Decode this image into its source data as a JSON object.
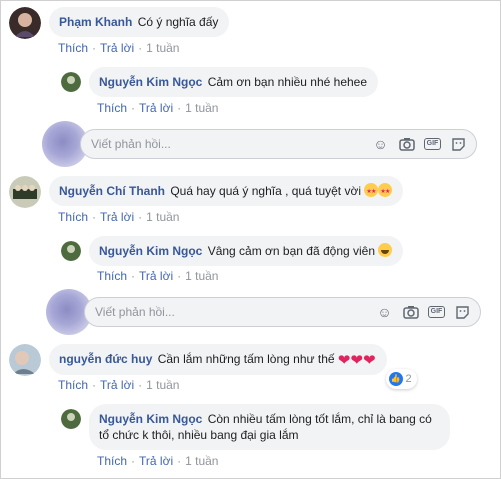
{
  "comments": [
    {
      "name": "Phạm Khanh",
      "text": "Có ý nghĩa đấy",
      "like": "Thích",
      "reply": "Trả lời",
      "time": "1 tuần"
    },
    {
      "name": "Nguyễn Kim Ngọc",
      "text": "Cảm ơn bạn nhiều nhé hehee",
      "like": "Thích",
      "reply": "Trả lời",
      "time": "1 tuần"
    },
    {
      "name": "Nguyễn Chí Thanh",
      "text": "Quá hay quá ý nghĩa , quá tuyệt vời",
      "emoji": "star-struck-icon",
      "like": "Thích",
      "reply": "Trả lời",
      "time": "1 tuần"
    },
    {
      "name": "Nguyễn Kim Ngọc",
      "text": "Vâng cảm ơn bạn đã động viên",
      "emoji": "grinning-face-icon",
      "like": "Thích",
      "reply": "Trả lời",
      "time": "1 tuần"
    },
    {
      "name": "nguyễn đức huy",
      "text": "Cần lắm những tấm lòng như thế",
      "emoji": "heart-icon",
      "like": "Thích",
      "reply": "Trả lời",
      "time": "1 tuần",
      "reaction_count": "2"
    },
    {
      "name": "Nguyễn Kim Ngọc",
      "text": "Còn nhiều tấm lòng tốt lắm, chỉ là bang có tổ chức k thôi, nhiều bang đại gia lắm",
      "like": "Thích",
      "reply": "Trả lời",
      "time": "1 tuần"
    }
  ],
  "reply_placeholder": "Viết phản hồi...",
  "reply_tools": [
    "emoji-icon",
    "camera-icon",
    "gif-icon",
    "sticker-icon"
  ],
  "colors": {
    "link": "#385898",
    "action": "#4267b2",
    "bubble": "#f2f3f5",
    "meta": "#90949c"
  }
}
